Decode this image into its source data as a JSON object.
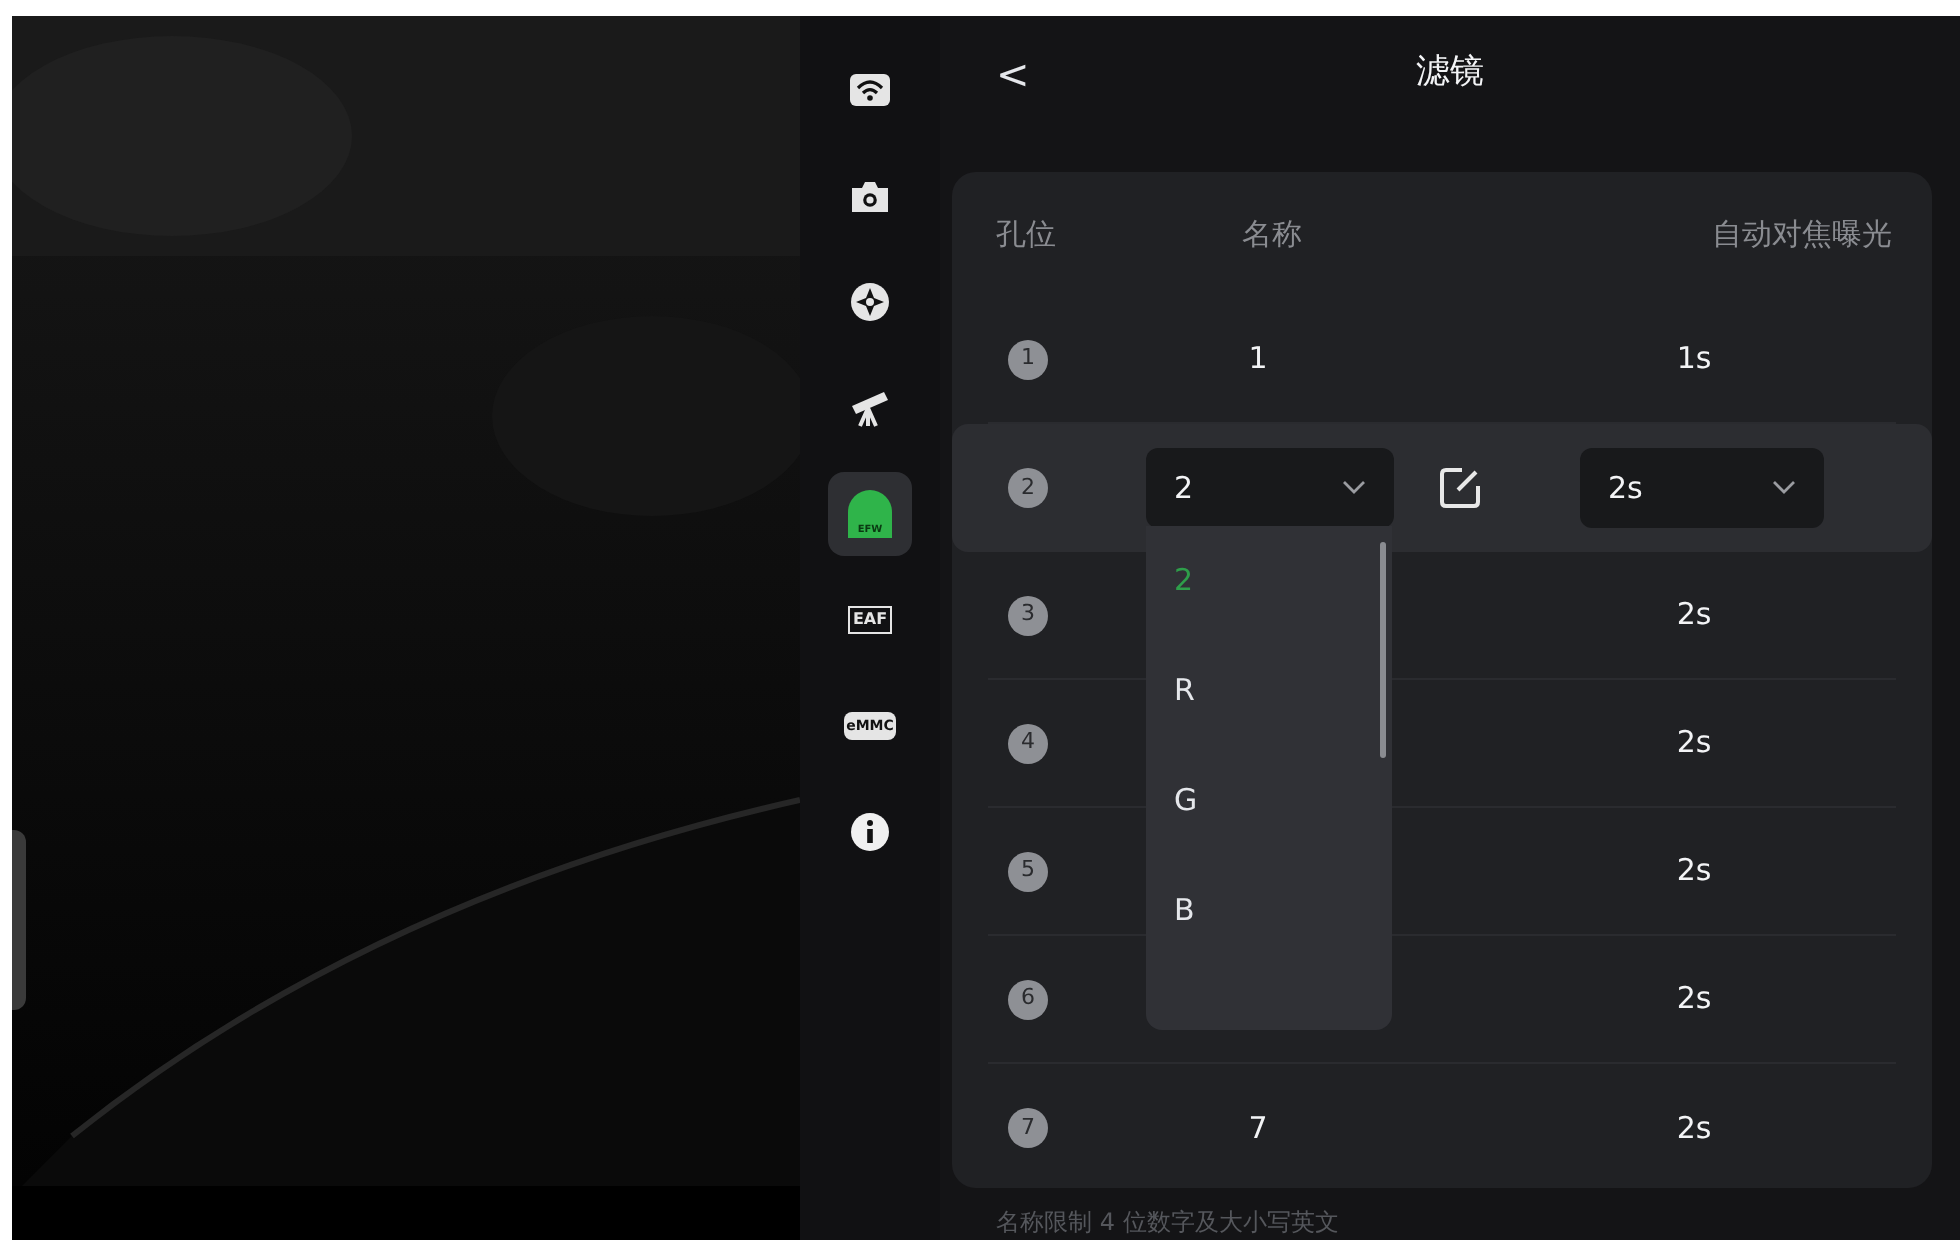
{
  "sidebar": {
    "items": [
      {
        "kind": "wifi",
        "selected": false
      },
      {
        "kind": "camera",
        "selected": false
      },
      {
        "kind": "target",
        "selected": false
      },
      {
        "kind": "telescope",
        "selected": false
      },
      {
        "kind": "wheel",
        "label": "EFW",
        "selected": true
      },
      {
        "kind": "focuser",
        "label": "EAF",
        "selected": false
      },
      {
        "kind": "storage",
        "label": "eMMC",
        "selected": false
      },
      {
        "kind": "info",
        "selected": false
      }
    ]
  },
  "header": {
    "back": "<",
    "title": "滤镜"
  },
  "table": {
    "columns": [
      "孔位",
      "名称",
      "自动对焦曝光"
    ],
    "rows": [
      {
        "index": "1",
        "name": "1",
        "exposure": "1s",
        "selected": false
      },
      {
        "index": "2",
        "name": "2",
        "exposure": "2s",
        "selected": true
      },
      {
        "index": "3",
        "exposure": "2s",
        "selected": false
      },
      {
        "index": "4",
        "exposure": "2s",
        "selected": false
      },
      {
        "index": "5",
        "exposure": "2s",
        "selected": false
      },
      {
        "index": "6",
        "exposure": "2s",
        "selected": false
      },
      {
        "index": "7",
        "name": "7",
        "exposure": "2s",
        "selected": false
      }
    ]
  },
  "dropdown": {
    "options": [
      {
        "label": "2",
        "selected": true
      },
      {
        "label": "R",
        "selected": false
      },
      {
        "label": "G",
        "selected": false
      },
      {
        "label": "B",
        "selected": false
      }
    ]
  },
  "footnote": "名称限制 4 位数字及大小写英文"
}
